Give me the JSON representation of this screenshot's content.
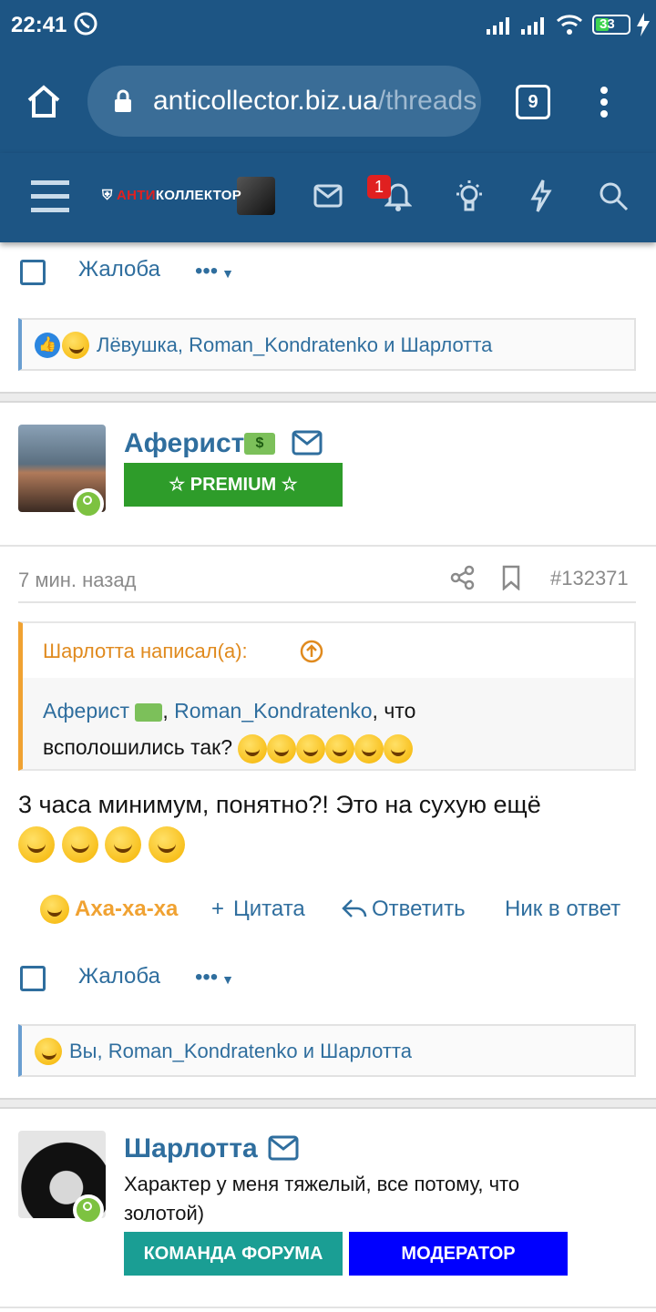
{
  "status_bar": {
    "time": "22:41",
    "battery": "33"
  },
  "browser": {
    "url_host": "anticollector.biz.ua",
    "url_rest": "/threads",
    "tab_count": "9"
  },
  "site_nav": {
    "logo_prefix": "АНТИ",
    "logo_suffix": "КОЛЛЕКТОР",
    "notification_count": "1"
  },
  "post_top": {
    "report_label": "Жалоба",
    "reactions_text": "Лёвушка, Roman_Kondratenko и Шарлотта"
  },
  "post_main": {
    "author": "Аферист",
    "author_badge": "☆ PREMIUM ☆",
    "time": "7 мин. назад",
    "post_number": "#132371",
    "quote_header": "Шарлотта написал(а):",
    "quote_mention1": "Аферист",
    "quote_mention2": "Roman_Kondratenko",
    "quote_text_after": ", что",
    "quote_line2": "всполошились так?",
    "body": "3 часа минимум, понятно?! Это на сухую ещё",
    "action_react": "Аха-ха-ха",
    "action_quote": "Цитата",
    "action_reply": "Ответить",
    "action_mention": "Ник в ответ",
    "report_label": "Жалоба",
    "reactions_text": "Вы, Roman_Kondratenko и Шарлотта"
  },
  "post_next": {
    "author": "Шарлотта",
    "user_title": "Характер у меня тяжелый, все потому, что золотой)",
    "badge1": "КОМАНДА ФОРУМА",
    "badge2": "МОДЕРАТОР"
  },
  "colors": {
    "header_bg": "#1d5584",
    "link": "#2f6e9e",
    "premium": "#2e9c2a",
    "team": "#1a9e94",
    "moderator": "#0000ff",
    "quote_accent": "#f0a232"
  }
}
